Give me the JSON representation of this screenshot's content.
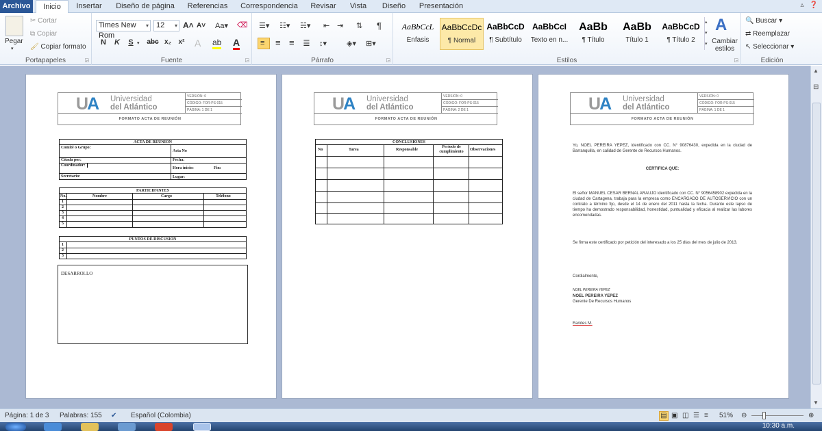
{
  "ribbon_tabs": [
    "Archivo",
    "Inicio",
    "Insertar",
    "Diseño de página",
    "Referencias",
    "Correspondencia",
    "Revisar",
    "Vista",
    "Diseño",
    "Presentación"
  ],
  "clipboard": {
    "paste": "Pegar",
    "cut": "Cortar",
    "copy": "Copiar",
    "format_painter": "Copiar formato",
    "label": "Portapapeles"
  },
  "font": {
    "name": "Times New Rom",
    "size": "12",
    "label": "Fuente",
    "grow": "A",
    "shrink": "A",
    "case": "Aa",
    "bold": "N",
    "italic": "K",
    "underline": "S",
    "strike": "abc",
    "sub": "x₂",
    "sup": "x²"
  },
  "paragraph": {
    "label": "Párrafo"
  },
  "styles": {
    "label": "Estilos",
    "items": [
      {
        "preview": "AaBbCcL",
        "name": "Énfasis"
      },
      {
        "preview": "AaBbCcDc",
        "name": "¶ Normal"
      },
      {
        "preview": "AaBbCcD",
        "name": "¶ Subtítulo"
      },
      {
        "preview": "AaBbCcI",
        "name": "Texto en n..."
      },
      {
        "preview": "AaBb",
        "name": "¶ Título"
      },
      {
        "preview": "AaBb",
        "name": "Título 1"
      },
      {
        "preview": "AaBbCcD",
        "name": "¶ Título 2"
      }
    ],
    "change": "Cambiar estilos"
  },
  "editing": {
    "find": "Buscar",
    "replace": "Reemplazar",
    "select": "Seleccionar",
    "label": "Edición"
  },
  "doc_header": {
    "ua": "UA",
    "uni_line1": "Universidad",
    "uni_line2": "del Atlántico",
    "version": "VERSIÓN: 0",
    "code": "CÓDIGO: FOR-PS-015",
    "format_title": "FORMATO  ACTA  DE REUNIÓN",
    "pages": [
      "PÁGINA: 1 DE 1",
      "PÁGINA: 2 DE 1",
      "PÁGINA: 1 DE 1"
    ]
  },
  "page1": {
    "acta": {
      "title": "ACTA DE REUNION",
      "comite": "Comité o Grupo:",
      "acta_no": "Acta No",
      "citada": "Citada por:",
      "fecha": "Fecha:",
      "coord": "Coordinador:",
      "hora": "Hora inicio:",
      "fin": "Fin:",
      "secretario": "Secretario:",
      "lugar": "Lugar:"
    },
    "participantes": {
      "title": "PARTICIPANTES",
      "cols": [
        "No.",
        "Nombre",
        "Cargo",
        "Teléfono"
      ],
      "rows": [
        "1",
        "2",
        "3",
        "4",
        "5"
      ]
    },
    "puntos": {
      "title": "PUNTOS DE DISCUSION",
      "rows": [
        "1",
        "2",
        "3"
      ]
    },
    "desarrollo": "DESARROLLO"
  },
  "page2": {
    "title": "CONCLUSIONES",
    "cols": [
      "No",
      "Tarea",
      "Responsable",
      "Periodo de cumplimiento",
      "Observaciones"
    ]
  },
  "page3": {
    "p1": "Yo, NOEL PEREIRA YEPEZ, identificado con CC. N° 90876430, expedida en la ciudad de Barranquilla, en calidad de Gerente de Recursos Humanos.",
    "certifica": "CERTIFICA QUE:",
    "p2": "El señor MANUEL CESAR BERNAL ARAUJO identificado con CC. N° 9056458902 expedida en la ciudad de Cartagena, trabaja para la empresa como ENCARGADO DE AUTOSERVICIO con un contrato a término fijo, desde el 14 de enero del 2011 hasta la fecha. Durante este lapso de tiempo ha demostrado responsabilidad, honestidad, puntualidad y eficacia al realizar las labores encomendadas.",
    "p3": "Se firma este certificado por petición del interesado a los 25 días del mes de julio de 2013.",
    "closing": "Cordialmente,",
    "sig_script": "NOEL PEREIRA YEPEZ",
    "signer": "NOEL PEREIRA YEPEZ",
    "role": "Gerente De Recursos Humanos",
    "initials": "Earides M."
  },
  "status": {
    "page": "Página: 1 de 3",
    "words": "Palabras: 155",
    "lang": "Español (Colombia)",
    "zoom": "51%"
  },
  "taskbar": {
    "clock": "10:30 a.m."
  },
  "colors": {
    "file_tab": "#2b5797",
    "workspace": "#abb9d3",
    "ua_blue": "#2f83c4"
  }
}
